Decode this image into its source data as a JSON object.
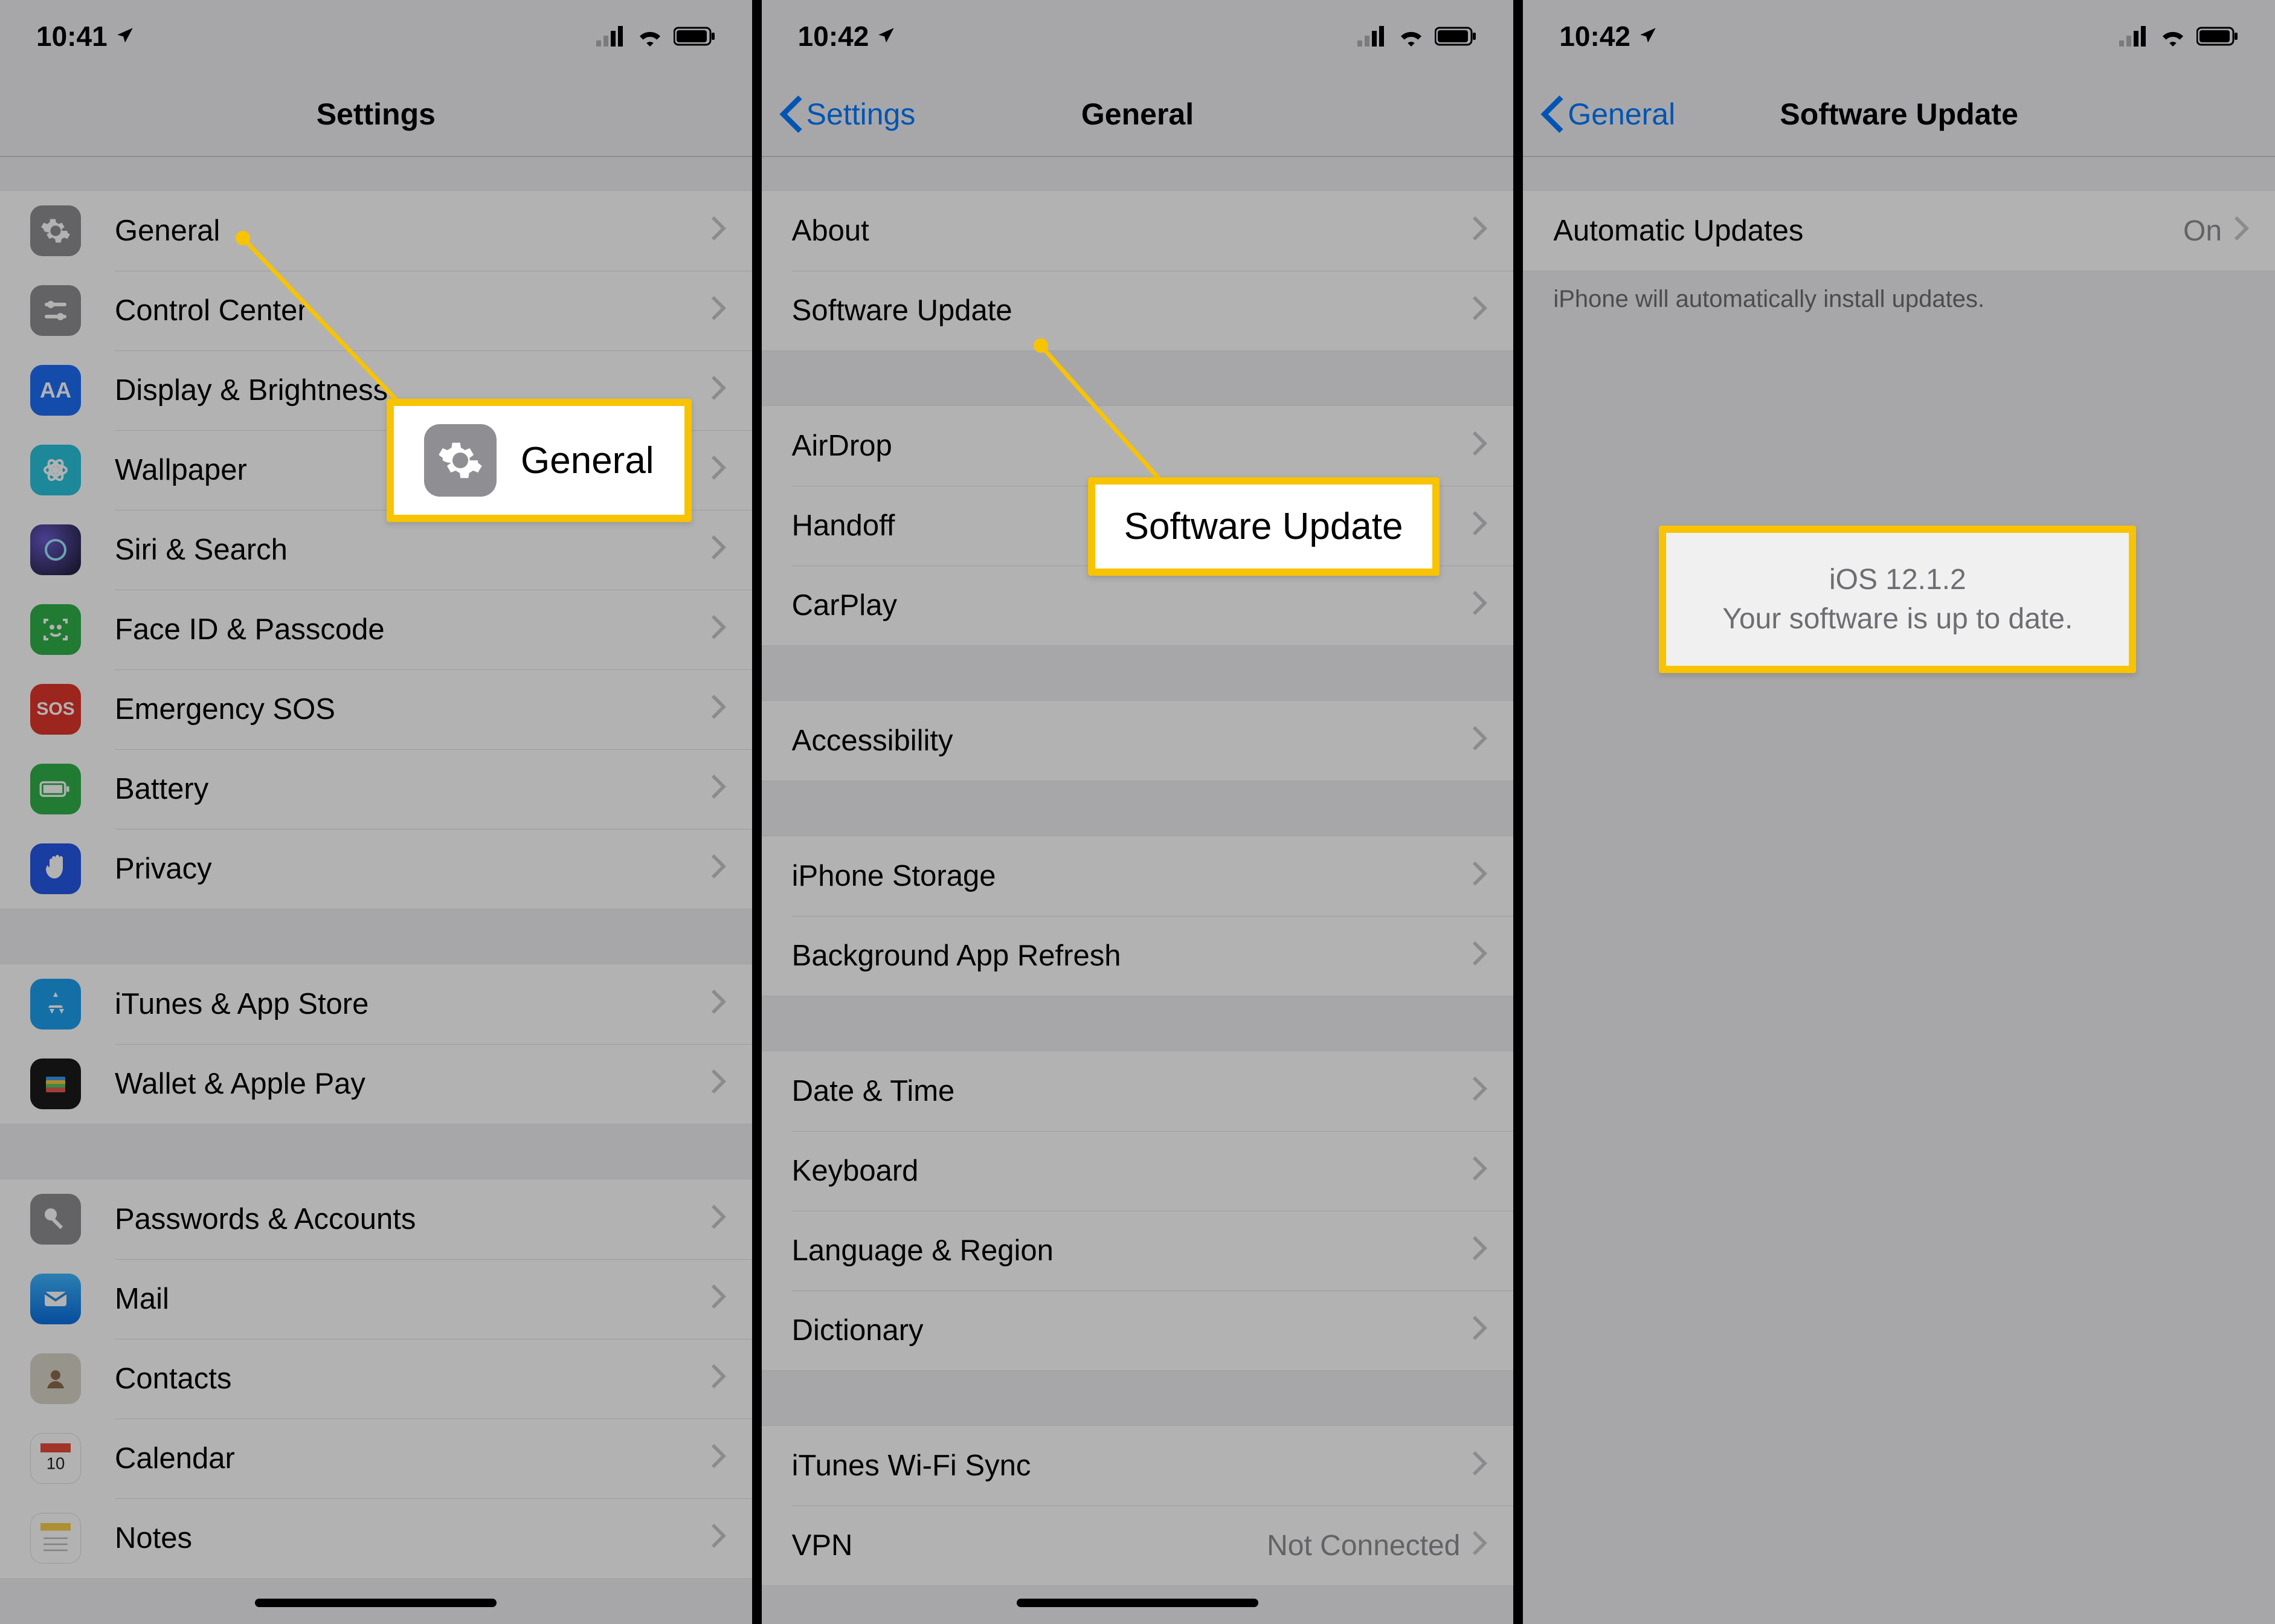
{
  "status": {
    "time1": "10:41",
    "time2": "10:42",
    "time3": "10:42"
  },
  "phone1": {
    "title": "Settings",
    "rows": {
      "general": "General",
      "control_center": "Control Center",
      "display": "Display & Brightness",
      "wallpaper": "Wallpaper",
      "siri": "Siri & Search",
      "faceid": "Face ID & Passcode",
      "sos": "Emergency SOS",
      "battery": "Battery",
      "privacy": "Privacy",
      "itunes": "iTunes & App Store",
      "wallet": "Wallet & Apple Pay",
      "passwords": "Passwords & Accounts",
      "mail": "Mail",
      "contacts": "Contacts",
      "calendar": "Calendar",
      "notes": "Notes"
    },
    "callout": "General"
  },
  "phone2": {
    "back": "Settings",
    "title": "General",
    "rows": {
      "about": "About",
      "software_update": "Software Update",
      "airdrop": "AirDrop",
      "handoff": "Handoff",
      "carplay": "CarPlay",
      "accessibility": "Accessibility",
      "iphone_storage": "iPhone Storage",
      "background_refresh": "Background App Refresh",
      "date_time": "Date & Time",
      "keyboard": "Keyboard",
      "language_region": "Language & Region",
      "dictionary": "Dictionary",
      "itunes_wifi": "iTunes Wi-Fi Sync",
      "vpn": "VPN",
      "vpn_value": "Not Connected"
    },
    "callout": "Software Update"
  },
  "phone3": {
    "back": "General",
    "title": "Software Update",
    "rows": {
      "auto_updates": "Automatic Updates",
      "auto_updates_value": "On"
    },
    "footer": "iPhone will automatically install updates.",
    "callout_version": "iOS 12.1.2",
    "callout_message": "Your software is up to date."
  },
  "icons": {
    "gear": "gear",
    "toggles": "control-center",
    "aa": "AA",
    "flower": "wallpaper",
    "siri": "siri",
    "face": "faceid",
    "sos": "SOS",
    "battery": "battery",
    "hand": "privacy",
    "appstore": "appstore",
    "wallet": "wallet",
    "key": "key",
    "mail": "mail",
    "contacts": "contacts",
    "calendar": "calendar",
    "notes": "notes"
  }
}
